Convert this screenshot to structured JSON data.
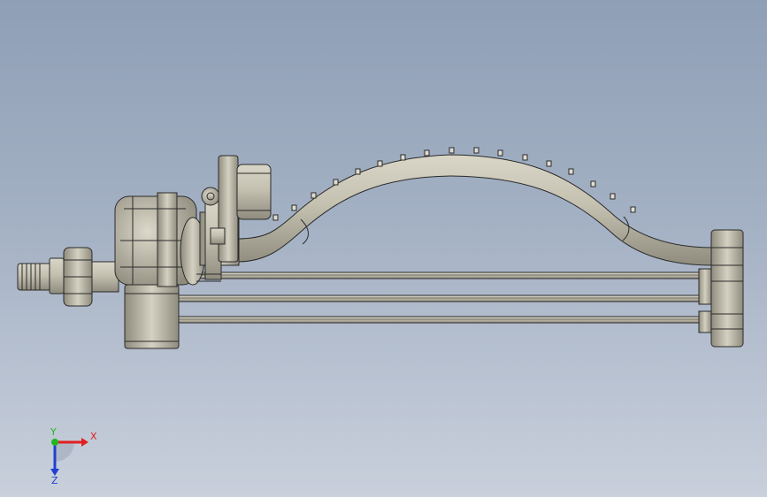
{
  "viewport": {
    "background_top": "#8f9fb6",
    "background_bottom": "#c9d0dc",
    "model_color": "#b3b09f",
    "outline_color": "#2a2a2a"
  },
  "triad": {
    "x_label": "X",
    "y_label": "Y",
    "z_label": "Z",
    "x_color": "#e02020",
    "y_color": "#1fb81f",
    "z_color": "#2040d0"
  }
}
